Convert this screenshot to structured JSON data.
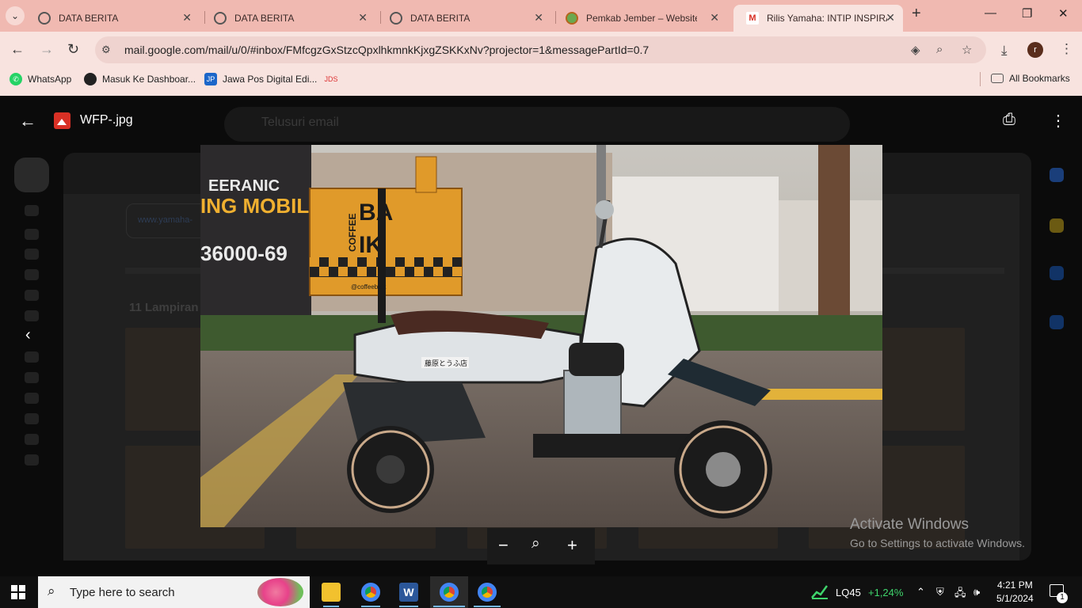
{
  "browser": {
    "tabs": [
      {
        "title": "DATA BERITA"
      },
      {
        "title": "DATA BERITA"
      },
      {
        "title": "DATA BERITA"
      },
      {
        "title": "Pemkab Jember – Website R"
      },
      {
        "title": "Rilis Yamaha: INTIP INSPIRAS"
      }
    ],
    "url": "mail.google.com/mail/u/0/#inbox/FMfcgzGxStzcQpxlhkmnkKjxgZSKKxNv?projector=1&messagePartId=0.7",
    "profile_initial": "r",
    "bookmarks": [
      "WhatsApp",
      "Masuk Ke Dashboar...",
      "Jawa Pos Digital Edi..."
    ],
    "all_bookmarks": "All Bookmarks"
  },
  "gmail": {
    "search_placeholder": "Telusuri email",
    "attachments_label": "11 Lampiran",
    "site_chip": "www.yamaha-"
  },
  "viewer": {
    "filename": "WFP-.jpg",
    "photo_box_text_1": "BA",
    "photo_box_text_2": "IK",
    "photo_box_vertical": "COFFEE",
    "photo_box_handle": "@coffeebaik",
    "photo_sign_1": "EERANIC",
    "photo_sign_2": "ING MOBIL",
    "photo_phone": "36000-69",
    "photo_sticker": "藤原とうふ店"
  },
  "watermark": {
    "line1": "Activate Windows",
    "line2": "Go to Settings to activate Windows."
  },
  "taskbar": {
    "search_placeholder": "Type here to search",
    "stock_name": "LQ45",
    "stock_change": "+1,24%",
    "time": "4:21 PM",
    "date": "5/1/2024",
    "notifications": "1"
  },
  "colors": {
    "tabstrip": "#f0b9b1",
    "toolbar": "#f8e3df",
    "stock_up": "#3fd46c",
    "box_orange": "#e09a2a"
  }
}
